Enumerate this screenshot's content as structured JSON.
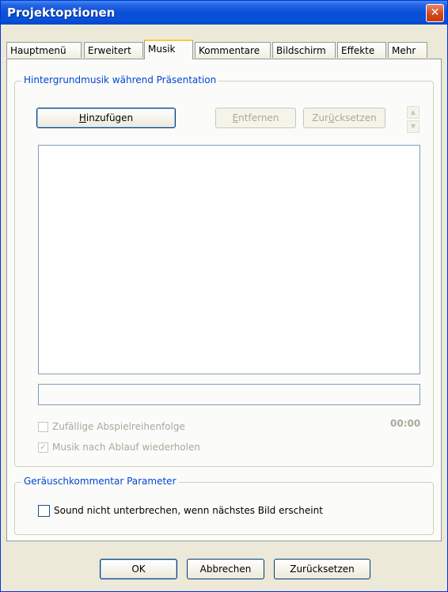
{
  "window": {
    "title": "Projektoptionen",
    "close_glyph": "✕"
  },
  "tabs": [
    {
      "label": "Hauptmenü"
    },
    {
      "label": "Erweitert"
    },
    {
      "label": "Musik"
    },
    {
      "label": "Kommentare"
    },
    {
      "label": "Bildschirm"
    },
    {
      "label": "Effekte"
    },
    {
      "label": "Mehr"
    }
  ],
  "active_tab": "Musik",
  "music_group": {
    "title": "Hintergrundmusik während Präsentation",
    "add_button": {
      "first": "H",
      "rest": "inzufügen"
    },
    "remove_button": {
      "first": "E",
      "rest": "ntfernen"
    },
    "reset_button": {
      "pre": "Zur",
      "ul": "ü",
      "post": "cksetzen"
    },
    "spin_up": "▲",
    "spin_down": "▼",
    "random_order": {
      "label": "Zufällige Abspielreihenfolge",
      "checked": false,
      "enabled": false
    },
    "repeat_music": {
      "label": "Musik nach Ablauf wiederholen",
      "checked": true,
      "enabled": false,
      "mark": "✓"
    },
    "time": "00:00"
  },
  "sound_group": {
    "title": "Geräuschkommentar Parameter",
    "dont_interrupt": {
      "label": "Sound nicht unterbrechen, wenn nächstes Bild erscheint",
      "checked": false
    }
  },
  "footer": {
    "ok": "OK",
    "cancel": "Abbrechen",
    "reset": "Zurücksetzen"
  },
  "colors": {
    "titlebar": "#0a4fd8",
    "group_title": "#0046d5",
    "tab_highlight": "#ffc83c",
    "dialog_bg": "#ece9d8"
  }
}
